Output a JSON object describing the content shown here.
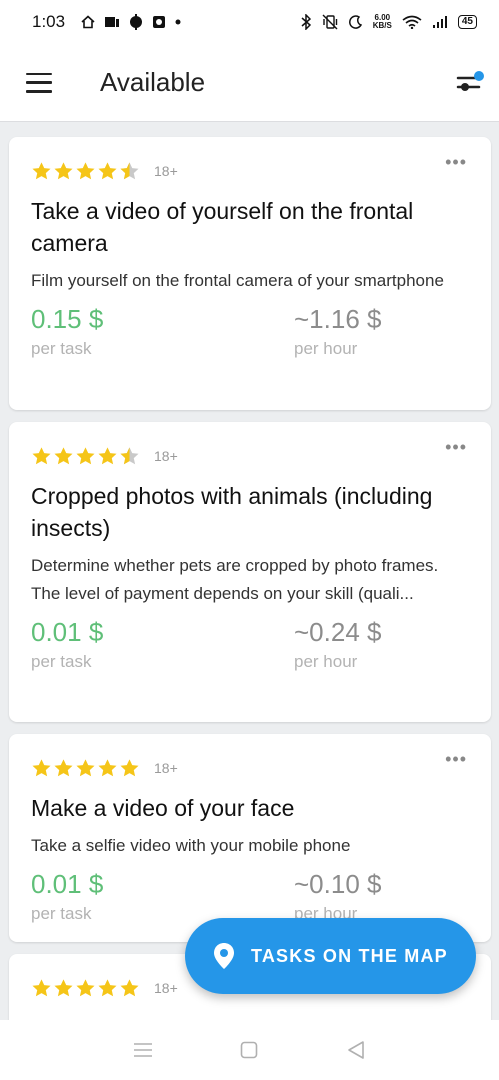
{
  "status_bar": {
    "time": "1:03",
    "net_speed_value": "6.00",
    "net_speed_unit": "KB/S",
    "battery": "45"
  },
  "app_bar": {
    "title": "Available"
  },
  "tasks": [
    {
      "rating": 4.5,
      "age": "18+",
      "title": "Take a video of yourself on the frontal camera",
      "description": "Film yourself on the frontal camera of your smartphone",
      "price_task": "0.15 $",
      "per_task": "per task",
      "price_hour": "~1.16 $",
      "per_hour": "per hour"
    },
    {
      "rating": 4.5,
      "age": "18+",
      "title": "Cropped photos with animals (including insects)",
      "description": "Determine whether pets are cropped by photo frames.",
      "description2": "The level of payment depends on your skill (quali...",
      "price_task": "0.01 $",
      "per_task": "per task",
      "price_hour": "~0.24 $",
      "per_hour": "per hour"
    },
    {
      "rating": 5,
      "age": "18+",
      "title": "Make a video of your face",
      "description": "Take a selfie video with your mobile phone",
      "price_task": "0.01 $",
      "per_task": "per task",
      "price_hour": "~0.10 $",
      "per_hour": "per hour"
    },
    {
      "rating": 5,
      "age": "18+"
    }
  ],
  "map_button": {
    "label": "TASKS ON THE MAP"
  },
  "colors": {
    "accent": "#2596e8",
    "price_green": "#5fbf78",
    "star": "#f5c518"
  }
}
